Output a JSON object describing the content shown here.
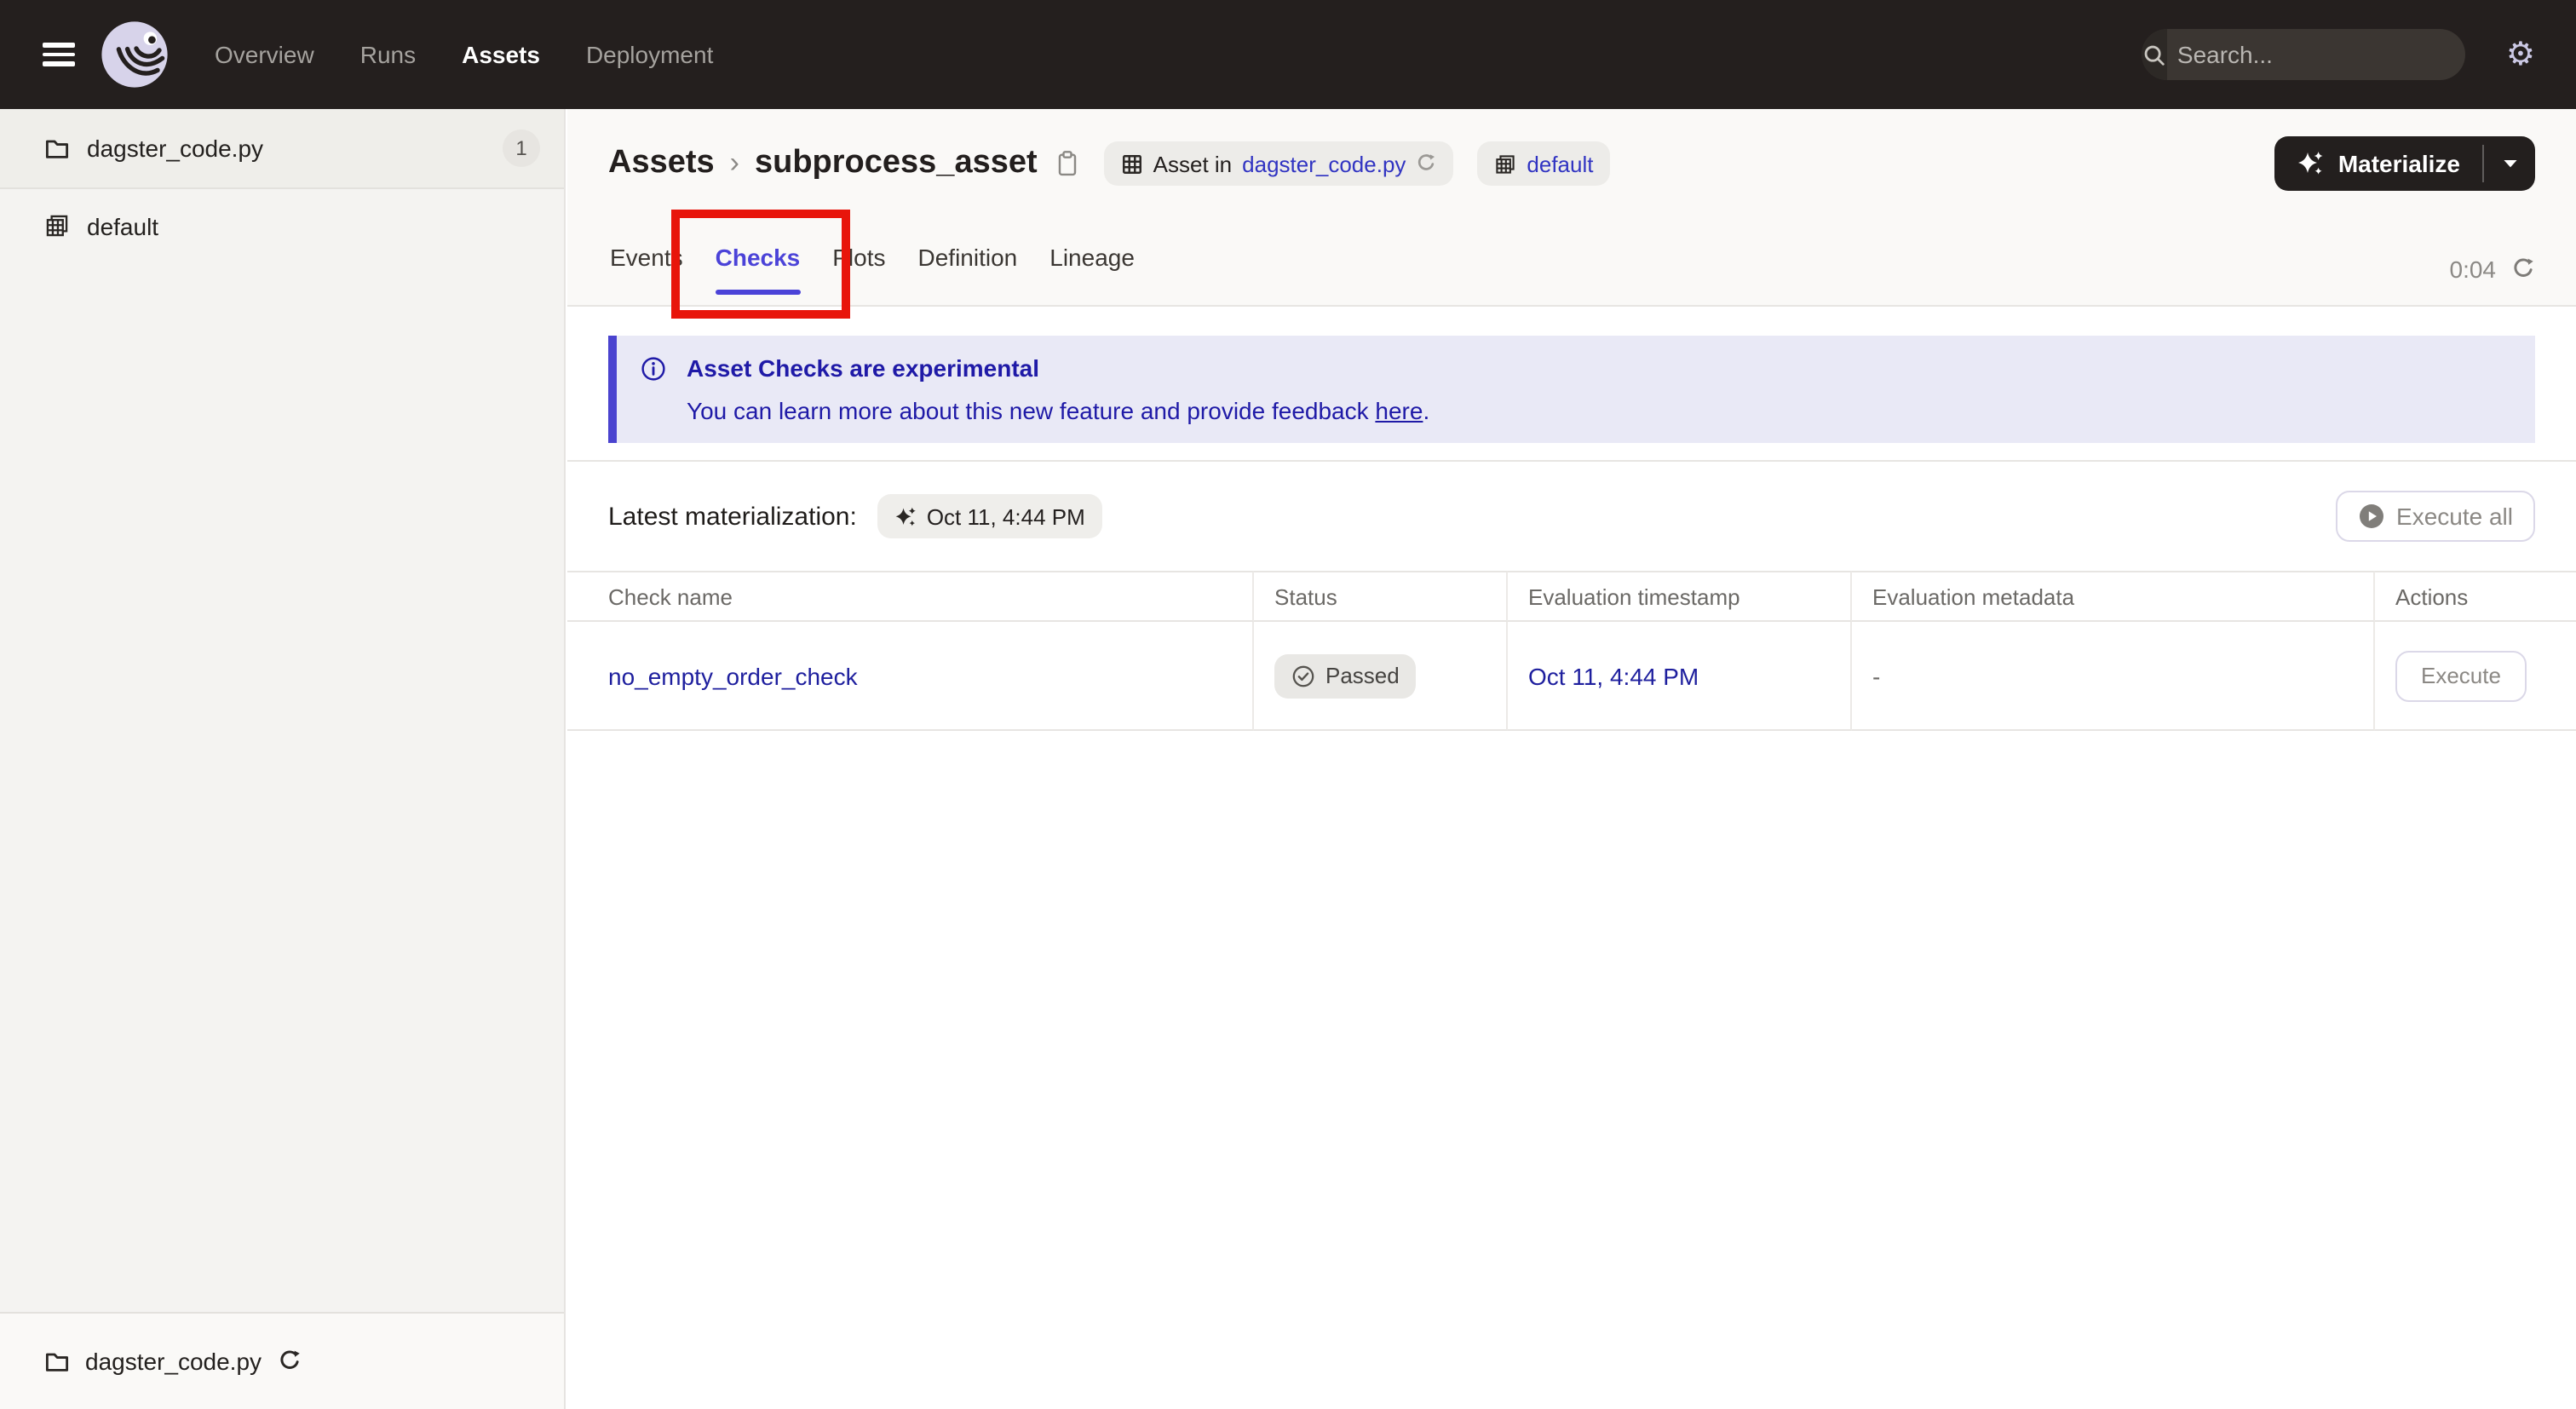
{
  "nav": {
    "items": [
      {
        "label": "Overview"
      },
      {
        "label": "Runs"
      },
      {
        "label": "Assets"
      },
      {
        "label": "Deployment"
      }
    ],
    "search": {
      "placeholder": "Search...",
      "shortcut": "/"
    },
    "gear_glyph": "⚙"
  },
  "sidebar": {
    "top_items": [
      {
        "label": "dagster_code.py",
        "badge": "1"
      },
      {
        "label": "default"
      }
    ],
    "bottom_item": {
      "label": "dagster_code.py"
    }
  },
  "header": {
    "breadcrumb": {
      "root": "Assets",
      "separator": "›",
      "current": "subprocess_asset"
    },
    "asset_chip": {
      "prefix": "Asset in",
      "link": "dagster_code.py"
    },
    "group_chip": {
      "label": "default"
    },
    "materialize": {
      "label": "Materialize"
    },
    "tabs": [
      {
        "label": "Events"
      },
      {
        "label": "Checks"
      },
      {
        "label": "Plots"
      },
      {
        "label": "Definition"
      },
      {
        "label": "Lineage"
      }
    ],
    "timer": "0:04"
  },
  "banner": {
    "title": "Asset Checks are experimental",
    "body": "You can learn more about this new feature and provide feedback ",
    "link_text": "here",
    "suffix": "."
  },
  "materialization": {
    "label": "Latest materialization:",
    "timestamp": "Oct 11, 4:44 PM",
    "execute_all_label": "Execute all"
  },
  "table": {
    "columns": [
      "Check name",
      "Status",
      "Evaluation timestamp",
      "Evaluation metadata",
      "Actions"
    ],
    "rows": [
      {
        "check_name": "no_empty_order_check",
        "status": "Passed",
        "timestamp": "Oct 11, 4:44 PM",
        "metadata": "-",
        "action_label": "Execute"
      }
    ]
  },
  "colors": {
    "accent": "#4B43D8",
    "banner_text": "#1F1AA7",
    "link": "#1E1F9E",
    "annotation_red": "#E8150B",
    "nav_bg": "#241F1E"
  }
}
